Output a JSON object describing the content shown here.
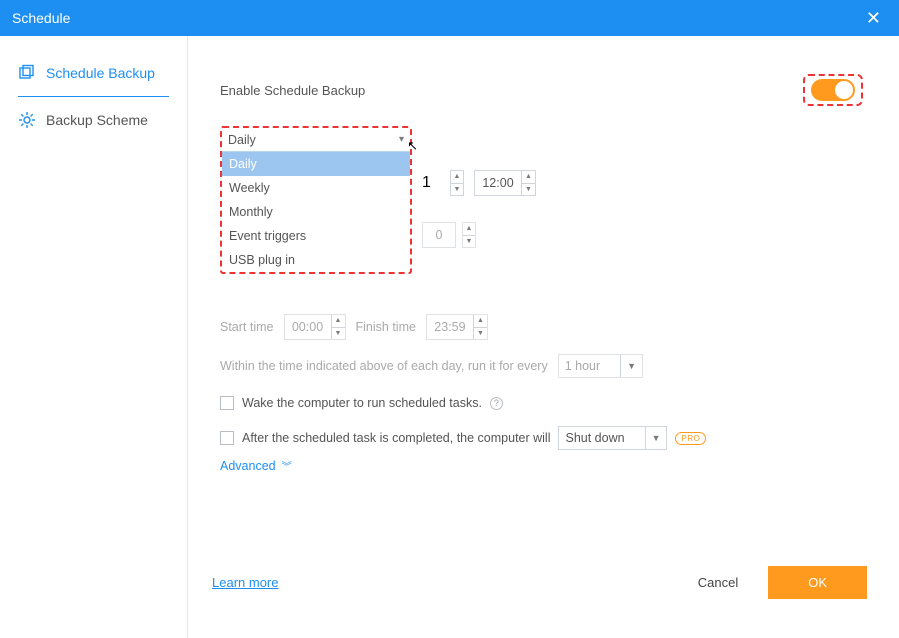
{
  "titlebar": {
    "title": "Schedule"
  },
  "sidebar": {
    "items": [
      {
        "label": "Schedule Backup"
      },
      {
        "label": "Backup Scheme"
      }
    ]
  },
  "main": {
    "enable_label": "Enable Schedule Backup",
    "toggle_on": true,
    "frequency": {
      "selected": "Daily",
      "options": [
        "Daily",
        "Weekly",
        "Monthly",
        "Event triggers",
        "USB plug in"
      ]
    },
    "time1_trail": "1",
    "time2": "12:00",
    "spin2_value": "0",
    "start_label": "Start time",
    "start_value": "00:00",
    "finish_label": "Finish time",
    "finish_value": "23:59",
    "within_label": "Within the time indicated above of each day, run it for every",
    "within_select": "1 hour",
    "wake_label": "Wake the computer to run scheduled tasks.",
    "after_label": "After the scheduled task is completed, the computer will",
    "after_select": "Shut down",
    "pro_label": "PRO",
    "advanced_label": "Advanced"
  },
  "footer": {
    "learn": "Learn more",
    "cancel": "Cancel",
    "ok": "OK"
  },
  "colors": {
    "accent_blue": "#1e8ff2",
    "accent_orange": "#ff9a1f",
    "highlight_red": "#e33"
  }
}
